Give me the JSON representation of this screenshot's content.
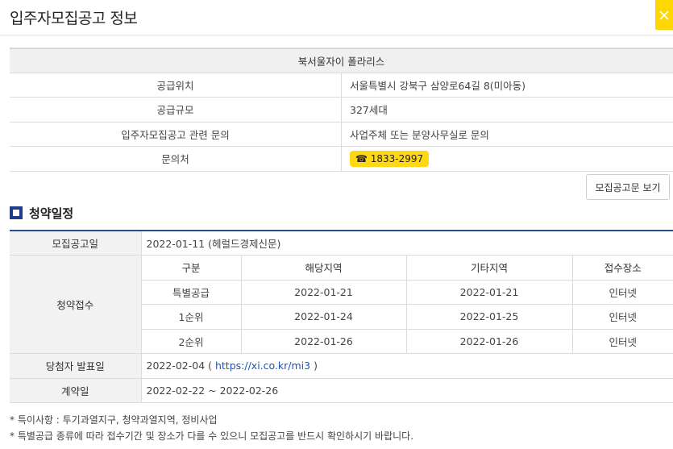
{
  "page": {
    "title": "입주자모집공고 정보"
  },
  "info": {
    "house_name": "북서울자이 폴라리스",
    "rows": [
      {
        "label": "공급위치",
        "value": "서울특별시 강북구 삼양로64길 8(미아동)"
      },
      {
        "label": "공급규모",
        "value": "327세대"
      },
      {
        "label": "입주자모집공고 관련 문의",
        "value": "사업주체 또는 분양사무실로 문의"
      }
    ],
    "contact": {
      "label": "문의처",
      "phone": "☎ 1833-2997"
    }
  },
  "buttons": {
    "notice": "모집공고문 보기"
  },
  "schedule": {
    "title": "청약일정",
    "announce": {
      "label": "모집공고일",
      "value": "2022-01-11 (헤럴드경제신문)"
    },
    "application": {
      "label": "청약접수",
      "headers": [
        "구분",
        "해당지역",
        "기타지역",
        "접수장소"
      ],
      "rows": [
        [
          "특별공급",
          "2022-01-21",
          "2022-01-21",
          "인터넷"
        ],
        [
          "1순위",
          "2022-01-24",
          "2022-01-25",
          "인터넷"
        ],
        [
          "2순위",
          "2022-01-26",
          "2022-01-26",
          "인터넷"
        ]
      ]
    },
    "winner": {
      "label": "당첨자 발표일",
      "date": "2022-02-04 (",
      "url": "https://xi.co.kr/mi3",
      "close": ")"
    },
    "contract": {
      "label": "계약일",
      "value": "2022-02-22 ~ 2022-02-26"
    }
  },
  "notes": [
    "* 특이사항 : 투기과열지구, 청약과열지역, 정비사업",
    "* 특별공급 종류에 따라 접수기간 및 장소가 다를 수 있으니 모집공고를 반드시 확인하시기 바랍니다."
  ],
  "colors": {
    "accent": "#ffd814",
    "header_line": "#2b4a9b",
    "section_icon": "#1e3d8c",
    "link": "#1a56b8"
  }
}
